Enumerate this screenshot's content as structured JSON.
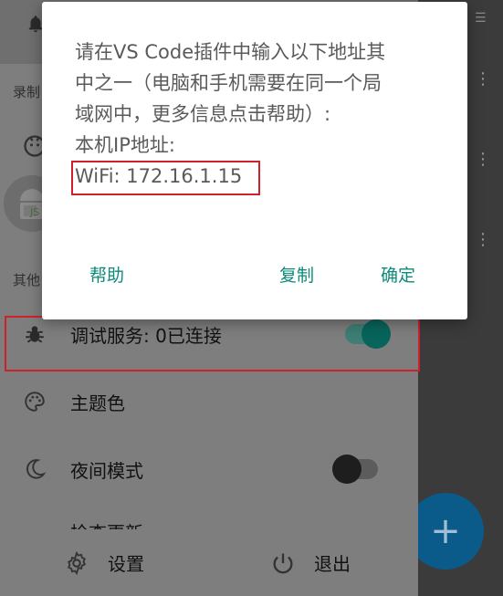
{
  "background": {
    "fab_label": "+"
  },
  "drawer": {
    "section_record_label": "录制",
    "section_other_label": "其他",
    "debug_service_label": "调试服务: 0已连接",
    "debug_service_on": true,
    "theme_color_label": "主题色",
    "night_mode_label": "夜间模式",
    "night_mode_on": false,
    "partial_item_label": "检查更新",
    "footer": {
      "settings_label": "设置",
      "exit_label": "退出"
    }
  },
  "dialog": {
    "message_lines": [
      "请在VS Code插件中输入以下地址其",
      "中之一（电脑和手机需要在同一个局",
      "域网中，更多信息点击帮助）:",
      "本机IP地址:",
      "WiFi: 172.16.1.15"
    ],
    "help_label": "帮助",
    "copy_label": "复制",
    "ok_label": "确定"
  },
  "colors": {
    "accent": "#0d8a79",
    "highlight": "#d0202a",
    "fab": "#0a5b8a"
  }
}
